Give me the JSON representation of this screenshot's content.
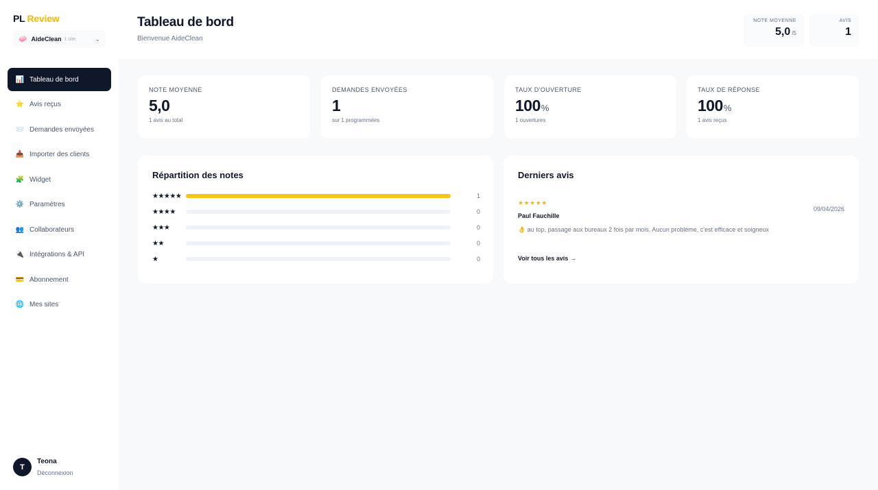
{
  "brand": {
    "pl": "PL",
    "review": "Review"
  },
  "site_selector": {
    "icon": "🧼",
    "name": "AideClean",
    "count": "1 site",
    "chevron": "⌄"
  },
  "nav": [
    {
      "icon": "📊",
      "label": "Tableau de bord",
      "active": true
    },
    {
      "icon": "⭐",
      "label": "Avis reçus"
    },
    {
      "icon": "📨",
      "label": "Demandes envoyées"
    },
    {
      "icon": "📥",
      "label": "Importer des clients"
    },
    {
      "icon": "🧩",
      "label": "Widget"
    },
    {
      "icon": "⚙️",
      "label": "Paramètres"
    },
    {
      "icon": "👥",
      "label": "Collaborateurs"
    },
    {
      "icon": "🔌",
      "label": "Intégrations & API"
    },
    {
      "icon": "💳",
      "label": "Abonnement"
    },
    {
      "icon": "🌐",
      "label": "Mes sites"
    }
  ],
  "user": {
    "initial": "T",
    "name": "Teona",
    "logout": "Déconnexion"
  },
  "header": {
    "title": "Tableau de bord",
    "subtitle": "Bienvenue AideClean",
    "stats": [
      {
        "label": "NOTE MOYENNE",
        "value": "5,0",
        "suffix": "/5"
      },
      {
        "label": "AVIS",
        "value": "1",
        "suffix": ""
      }
    ]
  },
  "kpis": [
    {
      "label": "NOTE MOYENNE",
      "value": "5,0",
      "unit": "",
      "sub": "1 avis au total"
    },
    {
      "label": "DEMANDES ENVOYÉES",
      "value": "1",
      "unit": "",
      "sub": "sur 1 programmées"
    },
    {
      "label": "TAUX D'OUVERTURE",
      "value": "100",
      "unit": "%",
      "sub": "1 ouvertures"
    },
    {
      "label": "TAUX DE RÉPONSE",
      "value": "100",
      "unit": "%",
      "sub": "1 avis reçus"
    }
  ],
  "distribution": {
    "title": "Répartition des notes",
    "rows": [
      {
        "stars": "★★★★★",
        "count": "1",
        "fraction": 1
      },
      {
        "stars": "★★★★",
        "count": "0",
        "fraction": 0
      },
      {
        "stars": "★★★",
        "count": "0",
        "fraction": 0
      },
      {
        "stars": "★★",
        "count": "0",
        "fraction": 0
      },
      {
        "stars": "★",
        "count": "0",
        "fraction": 0
      }
    ]
  },
  "latest_reviews": {
    "title": "Derniers avis",
    "items": [
      {
        "stars": "★★★★★",
        "author": "Paul Fauchille",
        "date": "09/04/2026",
        "text": "👌 au top, passage aux bureaux 2 fois par mois. Aucun problème, c'est efficace et soigneux"
      }
    ],
    "see_all": "Voir tous les avis →"
  },
  "colors": {
    "accent": "#f5c518",
    "dark": "#0f172a",
    "brand_yellow": "#f5b800"
  }
}
